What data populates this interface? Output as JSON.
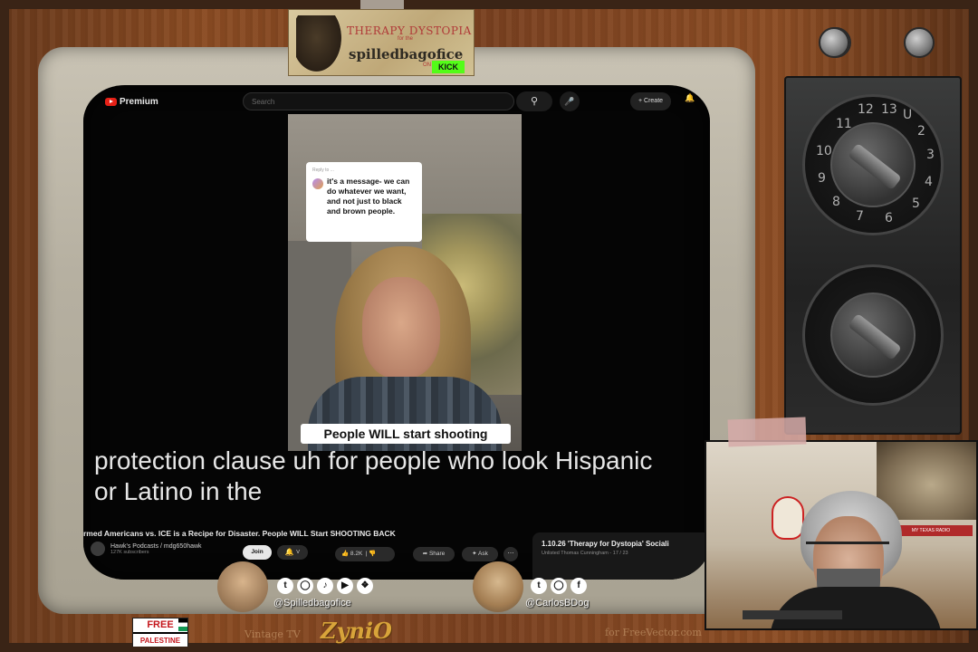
{
  "banner": {
    "line1": "THERAPY DYSTOPIA",
    "line2": "for the",
    "line3": "spilledbagofice",
    "on": "ON",
    "kick": "KICK"
  },
  "youtube": {
    "logo": "Premium",
    "search_placeholder": "Search",
    "create_label": "+ Create",
    "reply_meta": "Reply to ...",
    "reply_text": "it's a message- we can do whatever we want, and not just to black and brown people.",
    "video_caption": "People WILL start shooting",
    "subtitles": "protection clause uh for people who look Hispanic or Latino in the",
    "video_title": "rmed Americans vs. ICE is a Recipe for Disaster. People WILL Start SHOOTING BACK",
    "channel_name": "Hawk's Podcasts / mdg650hawk",
    "channel_subs": "127K subscribers",
    "join_label": "Join",
    "like_count": "8.2K",
    "share_label": "Share",
    "ask_label": "Ask",
    "playlist_title": "1.10.26 'Therapy for Dystopia' Sociali",
    "playlist_sub": "Unlisted Thomas Cunningham - 17 / 23"
  },
  "dials": {
    "top_numbers": [
      "12",
      "13",
      "U",
      "11",
      "2",
      "10",
      "3",
      "9",
      "4",
      "8",
      "5",
      "7",
      "6"
    ]
  },
  "social": {
    "handle_left": "@Spilledbagofice",
    "handle_right": "@CarlosBDog"
  },
  "footer": {
    "fp_top": "FREE",
    "fp_bottom": "PALESTINE",
    "brand_left": "Vintage TV",
    "brand": "ZyniO",
    "right_text": "for FreeVector.com"
  },
  "webcam": {
    "sign_text": "MY TEXAS RADIO"
  }
}
